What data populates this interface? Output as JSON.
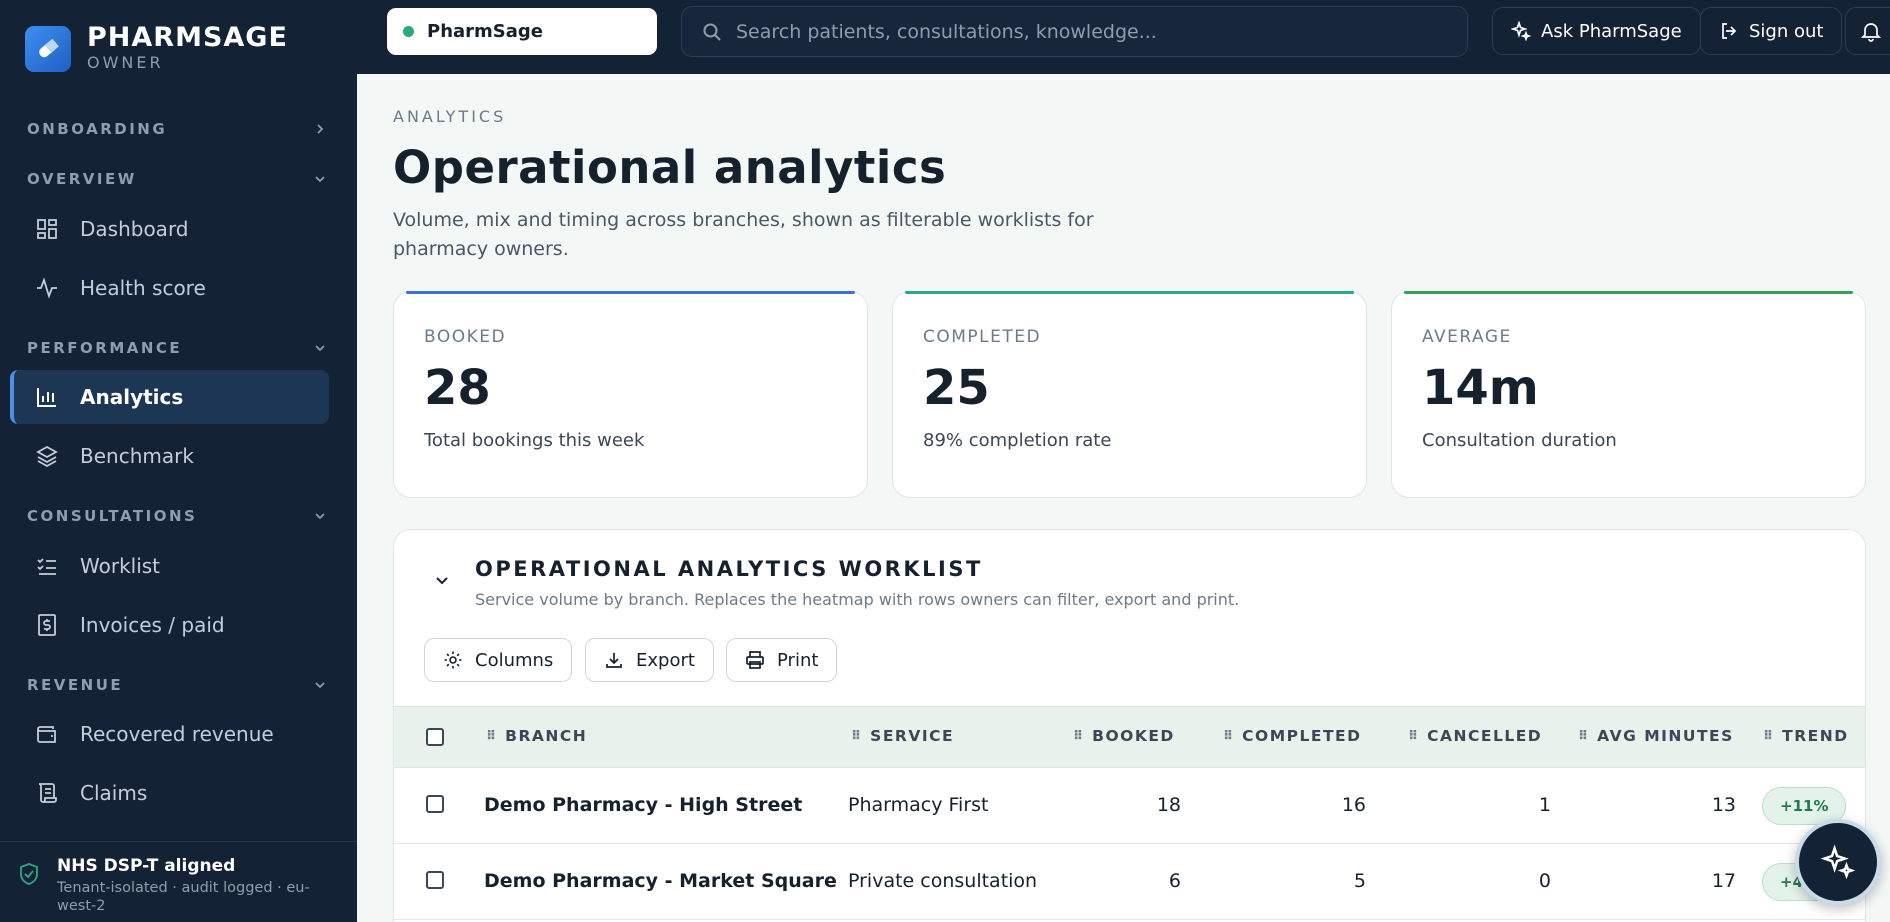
{
  "brand": {
    "name": "PHARMSAGE",
    "role": "OWNER"
  },
  "sidebar": {
    "sections": [
      {
        "label": "ONBOARDING"
      },
      {
        "label": "OVERVIEW"
      },
      {
        "label": "PERFORMANCE"
      },
      {
        "label": "CONSULTATIONS"
      },
      {
        "label": "REVENUE"
      }
    ],
    "items": [
      {
        "label": "Dashboard",
        "icon": "dashboard-icon"
      },
      {
        "label": "Health score",
        "icon": "pulse-icon"
      },
      {
        "label": "Analytics",
        "icon": "bar-chart-icon",
        "active": true
      },
      {
        "label": "Benchmark",
        "icon": "layers-icon"
      },
      {
        "label": "Worklist",
        "icon": "checklist-icon"
      },
      {
        "label": "Invoices / paid",
        "icon": "dollar-receipt-icon"
      },
      {
        "label": "Recovered revenue",
        "icon": "wallet-icon"
      },
      {
        "label": "Claims",
        "icon": "scroll-icon"
      }
    ],
    "footer": {
      "title": "NHS DSP-T aligned",
      "subtitle": "Tenant-isolated · audit logged · eu-west-2"
    }
  },
  "topbar": {
    "tenant": "PharmSage",
    "search_placeholder": "Search patients, consultations, knowledge...",
    "ask_label": "Ask PharmSage",
    "signout_label": "Sign out"
  },
  "page": {
    "eyebrow": "ANALYTICS",
    "title": "Operational analytics",
    "subtitle": "Volume, mix and timing across branches, shown as filterable worklists for pharmacy owners."
  },
  "kpis": [
    {
      "label": "BOOKED",
      "value": "28",
      "desc": "Total bookings this week"
    },
    {
      "label": "COMPLETED",
      "value": "25",
      "desc": "89% completion rate"
    },
    {
      "label": "AVERAGE",
      "value": "14m",
      "desc": "Consultation duration"
    }
  ],
  "worklist": {
    "title": "OPERATIONAL ANALYTICS WORKLIST",
    "subtitle": "Service volume by branch. Replaces the heatmap with rows owners can filter, export and print.",
    "buttons": {
      "columns": "Columns",
      "export": "Export",
      "print": "Print"
    },
    "columns": [
      "BRANCH",
      "SERVICE",
      "BOOKED",
      "COMPLETED",
      "CANCELLED",
      "AVG MINUTES",
      "TREND"
    ],
    "rows": [
      {
        "branch": "Demo Pharmacy - High Street",
        "service": "Pharmacy First",
        "booked": "18",
        "completed": "16",
        "cancelled": "1",
        "avg": "13",
        "trend": "+11%"
      },
      {
        "branch": "Demo Pharmacy - Market Square",
        "service": "Private consultation",
        "booked": "6",
        "completed": "5",
        "cancelled": "0",
        "avg": "17",
        "trend": "+4%"
      }
    ]
  },
  "colors": {
    "sidebar": "#142235",
    "accent": "#4f8fe6",
    "page_bg": "#f3f7f5",
    "trend_bg": "#e3f3ea"
  }
}
